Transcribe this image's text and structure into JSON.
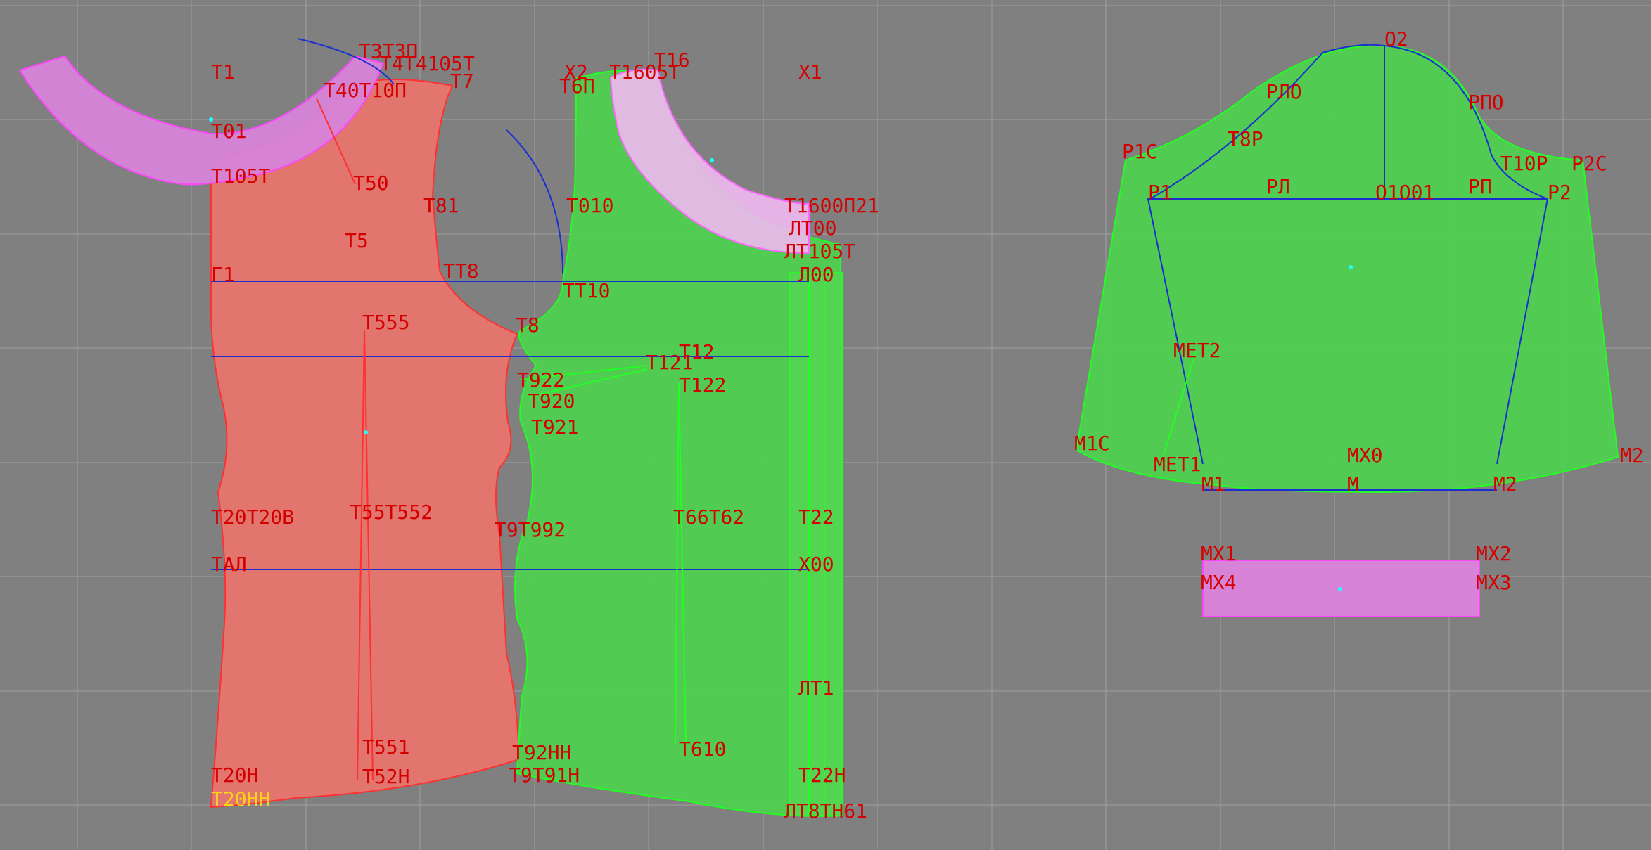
{
  "colors": {
    "background": "#808080",
    "grid": "#9a9a9a",
    "back_piece_fill": "#e8746e",
    "back_piece_stroke": "#ff3030",
    "front_piece_fill": "#4fcf4f",
    "front_piece_stroke": "#22ff22",
    "facing_fill": "#d783d8",
    "facing_stroke": "#ff44ff",
    "sleeve_fill": "#4fcf4f",
    "construction_line": "#1a2fd0",
    "point_label": "#d40000",
    "selected_label": "#ffd21a",
    "center_marker": "#22ffff"
  },
  "labels": {
    "t1": "Т1",
    "t01": "Т01",
    "t105t": "Т105Т",
    "t50": "Т50",
    "t5": "Т5",
    "g1": "Г1",
    "tt8": "ТТ8",
    "t555": "Т555",
    "t8": "Т8",
    "t20_t20v": "Т20Т20В",
    "t55_t552": "Т55Т552",
    "tal": "ТАЛ",
    "t551": "Т551",
    "t20n": "Т20Н",
    "t52_t52nn": "Т52Н",
    "t20nn": "Т20НН",
    "t_top1": "Т3Т3П",
    "t_top2": "Т4Т4105Т",
    "t_top3": "Т7",
    "t_top4": "Т40Т10П",
    "t8_1": "Т81",
    "t8_2": "Т8",
    "x2": "Х2",
    "t16": "Т16",
    "t16_05t": "Т1605Т",
    "t_6p": "Т6П",
    "x1": "Х1",
    "t010": "Т010",
    "t_right1": "Т1600П21",
    "lt00": "ЛТ00",
    "lt_right2": "ЛТ105Т",
    "l00": "Л00",
    "tt10": "ТТ10",
    "t12": "Т12",
    "t121": "Т121",
    "t922": "Т922",
    "t122": "Т122",
    "t920": "Т920",
    "t921": "Т921",
    "t9_992": "Т9Т992",
    "t6_62": "Т66Т62",
    "t22": "Т22",
    "x00": "Х00",
    "lt1": "ЛТ1",
    "t610": "Т610",
    "t92nn": "Т92НН",
    "t9_91n": "Т9Т91Н",
    "t22n": "Т22Н",
    "lt_bottom": "ЛТ8ТН61",
    "o2": "О2",
    "rlo": "РЛО",
    "rpo": "РПО",
    "t8r": "Т8Р",
    "r1c": "Р1С",
    "t10r": "Т10Р",
    "r2c": "Р2С",
    "r1": "Р1",
    "rl": "РЛ",
    "o1_o01": "О1О01",
    "rp": "РП",
    "r2": "Р2",
    "met2": "МЕТ2",
    "m1c": "М1С",
    "met1": "МЕТ1",
    "mx0": "МХ0",
    "m2": "М2",
    "m1": "М1",
    "m": "М",
    "m2b": "М2",
    "mx1": "МХ1",
    "mx2": "МХ2",
    "mx4": "МХ4",
    "mx3": "МХ3"
  }
}
